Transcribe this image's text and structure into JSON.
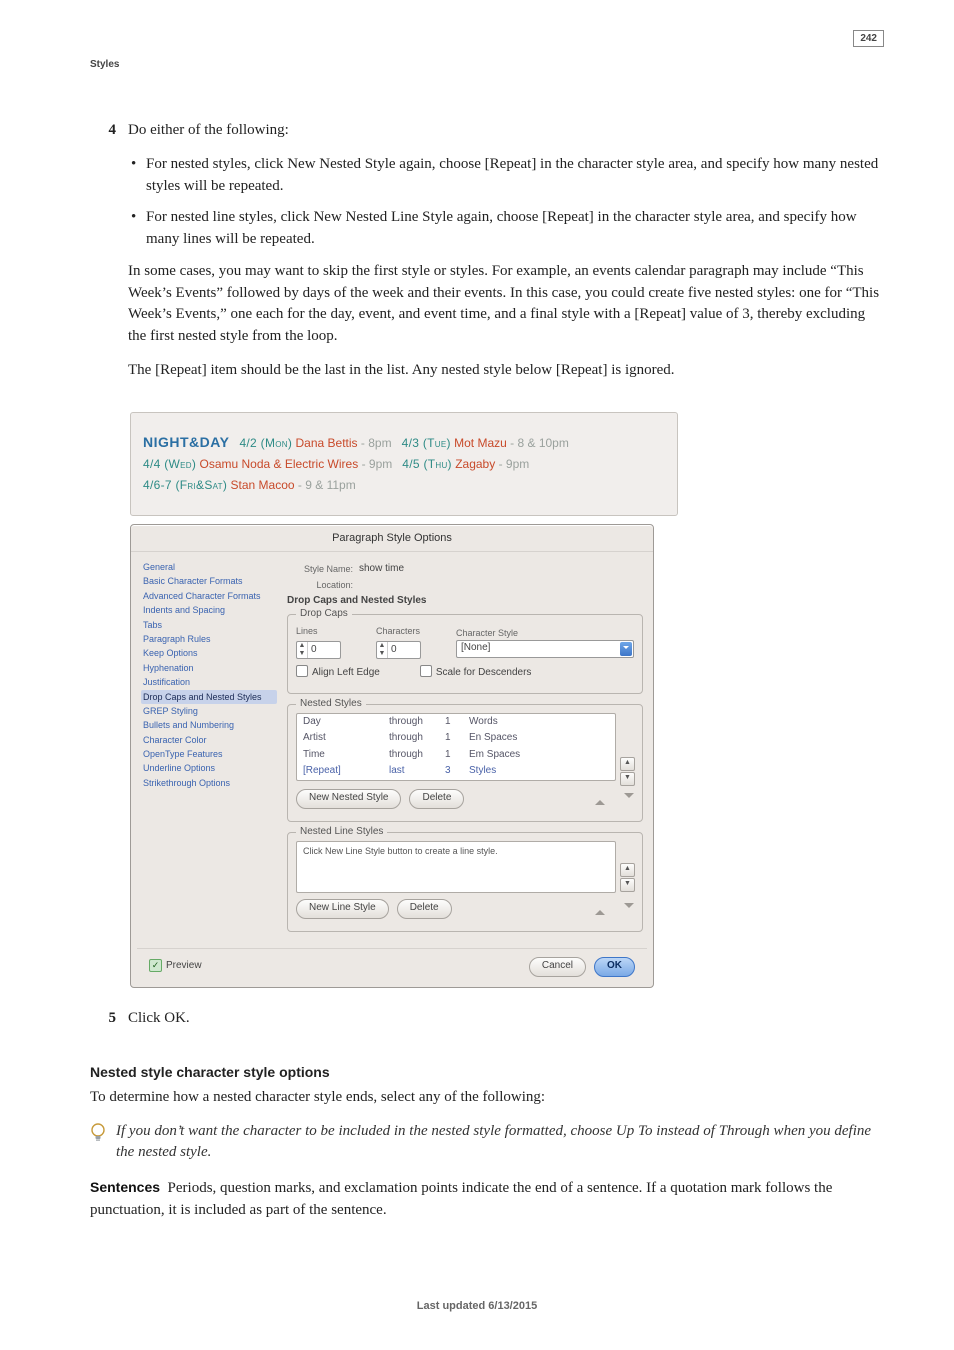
{
  "page": {
    "section": "Styles",
    "number": "242",
    "footer": "Last updated 6/13/2015"
  },
  "steps": {
    "s4": {
      "num": "4",
      "lead": "Do either of the following:",
      "b1": "For nested styles, click New Nested Style again, choose [Repeat] in the character style area, and specify how many nested styles will be repeated.",
      "b2": "For nested line styles, click New Nested Line Style again, choose [Repeat] in the character style area, and specify how many lines will be repeated.",
      "p1": "In some cases, you may want to skip the first style or styles. For example, an events calendar paragraph may include “This Week’s Events” followed by days of the week and their events. In this case, you could create five nested styles: one for “This Week’s Events,” one each for the day, event, and event time, and a final style with a [Repeat] value of 3, thereby excluding the first nested style from the loop.",
      "p2": "The [Repeat] item should be the last in the list. Any nested style below [Repeat] is ignored."
    },
    "s5": {
      "num": "5",
      "text": "Click OK."
    }
  },
  "nd": {
    "title": "NIGHT&DAY",
    "l1a": "4/2 (Mon)",
    "l1b": "Dana Bettis",
    "l1c": "- 8pm",
    "l1d": "4/3 (Tue)",
    "l1e": "Mot Mazu",
    "l1f": "- 8 & 10pm",
    "l2a": "4/4 (Wed)",
    "l2b": "Osamu Noda & Electric Wires",
    "l2c": "- 9pm",
    "l2d": "4/5 (Thu)",
    "l2e": "Zagaby",
    "l2f": "- 9pm",
    "l3a": "4/6-7 (Fri&Sat)",
    "l3b": "Stan Macoo",
    "l3c": "- 9 & 11pm"
  },
  "dlg": {
    "title": "Paragraph Style Options",
    "cats": [
      "General",
      "Basic Character Formats",
      "Advanced Character Formats",
      "Indents and Spacing",
      "Tabs",
      "Paragraph Rules",
      "Keep Options",
      "Hyphenation",
      "Justification",
      "Drop Caps and Nested Styles",
      "GREP Styling",
      "Bullets and Numbering",
      "Character Color",
      "OpenType Features",
      "Underline Options",
      "Strikethrough Options"
    ],
    "sel_index": 9,
    "styleNameLbl": "Style Name:",
    "styleName": "show time",
    "locationLbl": "Location:",
    "panelTitle": "Drop Caps and Nested Styles",
    "dropcaps": {
      "legend": "Drop Caps",
      "linesLbl": "Lines",
      "lines": "0",
      "charsLbl": "Characters",
      "chars": "0",
      "charStyleLbl": "Character Style",
      "charStyle": "[None]",
      "alignLeft": "Align Left Edge",
      "scaleDesc": "Scale for Descenders"
    },
    "nested": {
      "legend": "Nested Styles",
      "rows": [
        {
          "a": "Day",
          "b": "through",
          "c": "1",
          "d": "Words"
        },
        {
          "a": "Artist",
          "b": "through",
          "c": "1",
          "d": "En Spaces"
        },
        {
          "a": "Time",
          "b": "through",
          "c": "1",
          "d": "Em Spaces"
        },
        {
          "a": "[Repeat]",
          "b": "last",
          "c": "3",
          "d": "Styles"
        }
      ],
      "newBtn": "New Nested Style",
      "delBtn": "Delete"
    },
    "lines": {
      "legend": "Nested Line Styles",
      "empty": "Click New Line Style button to create a line style.",
      "newBtn": "New Line Style",
      "delBtn": "Delete"
    },
    "preview": "Preview",
    "cancel": "Cancel",
    "ok": "OK"
  },
  "sub": {
    "h": "Nested style character style options",
    "p": "To determine how a nested character style ends, select any of the following:",
    "tip": "If you don’t want the character to be included in the nested style formatted, choose Up To instead of Through when you define the nested style.",
    "sentLabel": "Sentences",
    "sentText": "  Periods, question marks, and exclamation points indicate the end of a sentence. If a quotation mark follows the punctuation, it is included as part of the sentence."
  }
}
